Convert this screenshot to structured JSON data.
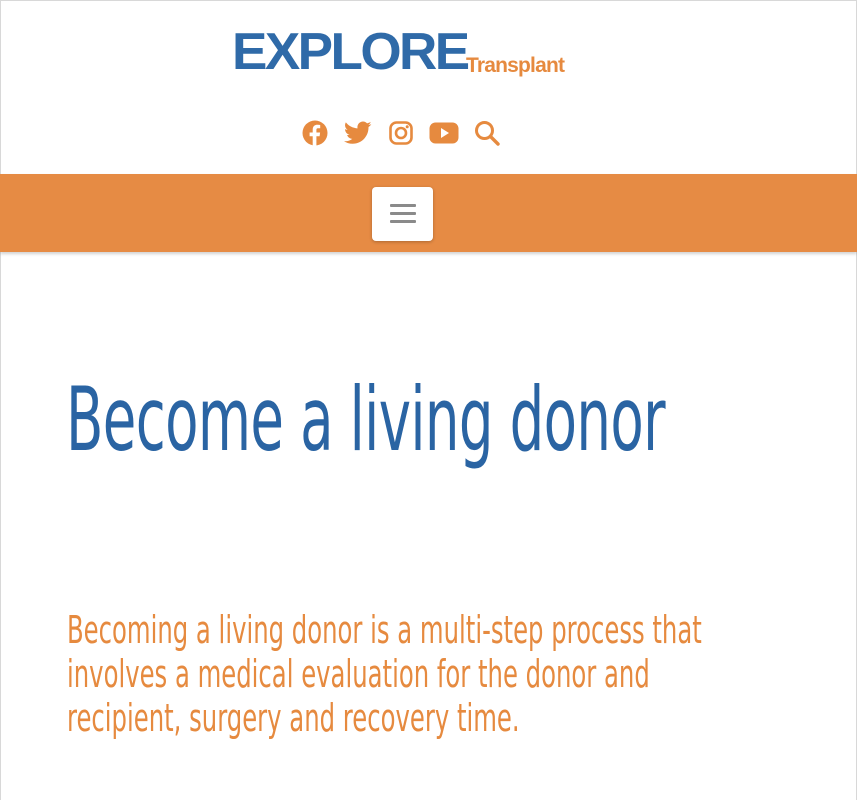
{
  "header": {
    "logo_main": "EXPLORE",
    "logo_sub": "Transplant"
  },
  "social": [
    {
      "name": "facebook-icon"
    },
    {
      "name": "twitter-icon"
    },
    {
      "name": "instagram-icon"
    },
    {
      "name": "youtube-icon"
    },
    {
      "name": "search-icon"
    }
  ],
  "nav": {
    "menu_icon": "hamburger-menu-icon"
  },
  "main": {
    "title": "Become a living donor",
    "subtitle": "Becoming a living donor is a multi-step process that involves a medical evaluation for the donor and recipient, surgery and recovery time."
  },
  "colors": {
    "brand_blue": "#2a64a3",
    "brand_orange": "#e68a3f",
    "nav_bg": "#e68b44"
  }
}
